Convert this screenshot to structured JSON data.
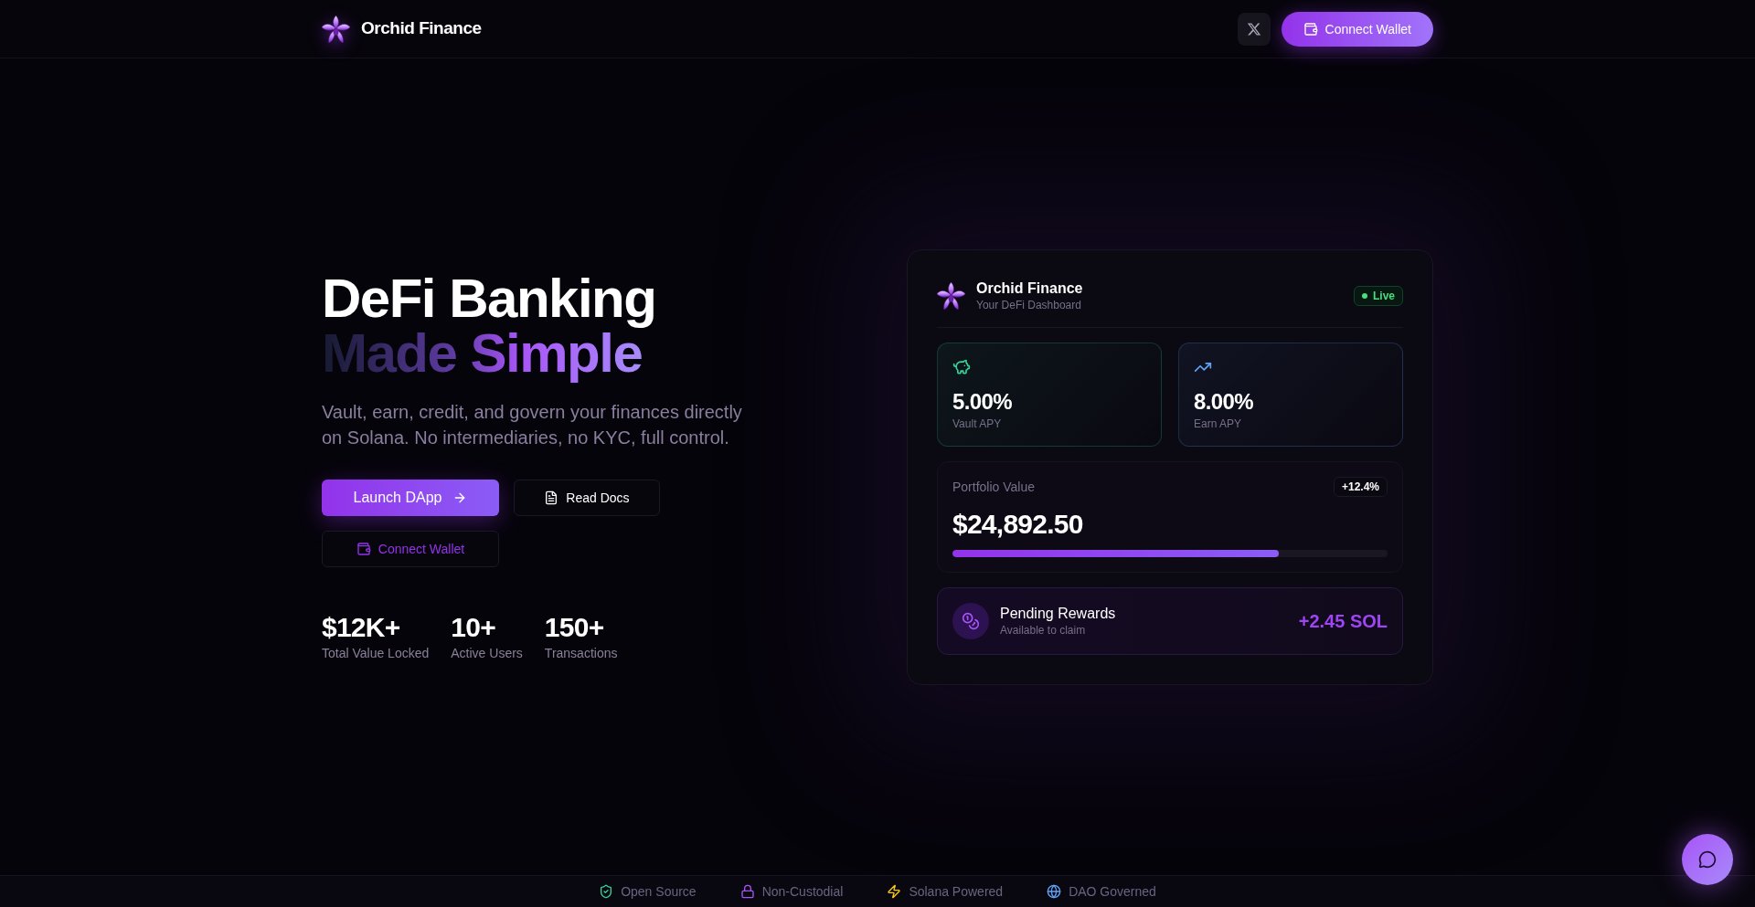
{
  "header": {
    "brand": "Orchid Finance",
    "connect_button": {
      "label": "Connect Wallet"
    }
  },
  "hero": {
    "title_line_1": "DeFi Banking",
    "title_line_2": "Made Simple",
    "description": "Vault, earn, credit, and govern your finances directly on Solana. No intermediaries, no KYC, full control.",
    "actions": [
      {
        "kind": "primary",
        "label": "Launch DApp"
      },
      {
        "kind": "docs",
        "label": "Read Docs"
      },
      {
        "kind": "wallet",
        "label": "Connect Wallet"
      }
    ],
    "stats": [
      {
        "value": "$12K+",
        "label": "Total Value Locked"
      },
      {
        "value": "10+",
        "label": "Active Users"
      },
      {
        "value": "150+",
        "label": "Transactions"
      }
    ]
  },
  "dashboard_card": {
    "title": "Orchid Finance",
    "subtitle": "Your DeFi Dashboard",
    "status": {
      "label": "Live"
    },
    "apy_cards": [
      {
        "kind": "vault",
        "value": "5.00%",
        "label": "Vault APY",
        "color": "#34d399"
      },
      {
        "kind": "earn",
        "value": "8.00%",
        "label": "Earn APY",
        "color": "#60a5fa"
      }
    ],
    "portfolio": {
      "label": "Portfolio Value",
      "change": "+12.4%",
      "value": "$24,892.50",
      "level": 0.75
    },
    "rewards": {
      "title": "Pending Rewards",
      "subtitle": "Available to claim",
      "amount": "+2.45 SOL"
    }
  },
  "features": [
    {
      "kind": "shield",
      "label": "Open Source",
      "color": "#34d399"
    },
    {
      "kind": "lock",
      "label": "Non-Custodial",
      "color": "#a855f7"
    },
    {
      "kind": "zap",
      "label": "Solana Powered",
      "color": "#facc15"
    },
    {
      "kind": "globe",
      "label": "DAO Governed",
      "color": "#60a5fa"
    }
  ]
}
